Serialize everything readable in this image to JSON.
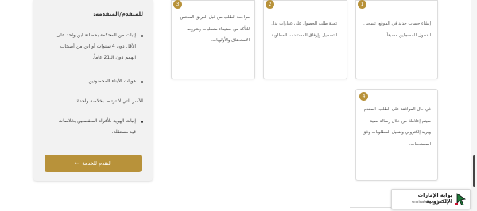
{
  "sidebar": {
    "heading": "للمتقدم/المتقدمة:",
    "requirements": [
      "إثبات من المحكمة بحضانة ابن واحد على الأقل دون 4 سنوات أو ابن من أصحاب الهمم دون الـ21 عاماً.",
      "هويات الأبناء المحضونين.",
      "للأسر التي لا ترتبط بخلاصة واحدة:",
      "إثبات الهوية للأفراد المنفصلين بخلاصات قيد مستقلة."
    ],
    "start_button": "التقدم للخدمة",
    "start_arrow": "←"
  },
  "steps": [
    {
      "number": "1",
      "text": "إنشاء حساب جديد في الموقع، تسجيل الدخول للمسجلين مسبقاً."
    },
    {
      "number": "2",
      "text": "تعبئة طلب الحصول على عقارات بدل التسجيل وإرفاق المستندات المطلوبة."
    },
    {
      "number": "3",
      "text": "مراجعة الطلب من قبل الفريق المختص للتأكد من استيفاء متطلبات وشروط الاستحقاق والأولويات."
    },
    {
      "number": "4",
      "text": "في حال الموافقة على الطلب، المقدم سيتم إعلامك من خلال رسالة نصية وبريد إلكتروني وتفعيل المطلوبات وفق المستحقات."
    }
  ],
  "portal": {
    "title": "بوابة الإمارات الإلكترونية",
    "url": "emiratesportal.com"
  },
  "colors": {
    "accent": "#b8923a"
  }
}
